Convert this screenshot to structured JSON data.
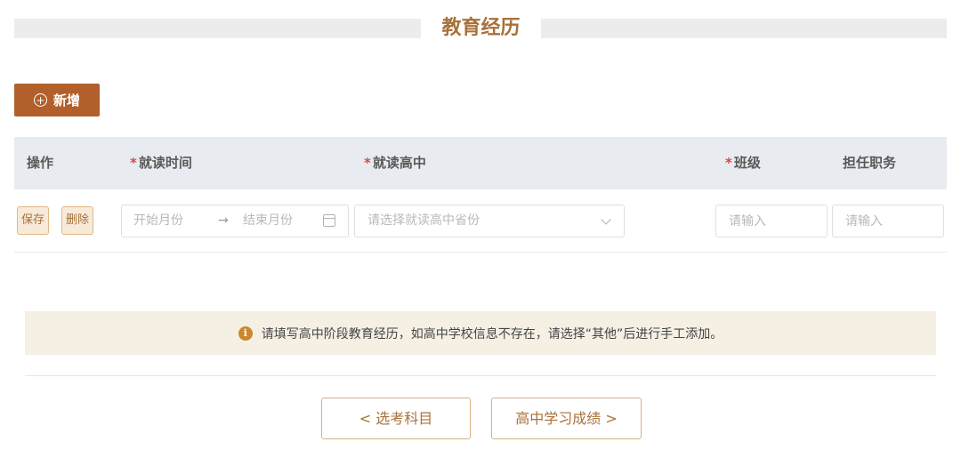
{
  "section": {
    "title": "教育经历"
  },
  "toolbar": {
    "add_label": "新增",
    "add_icon": "plus-circle-icon"
  },
  "table": {
    "columns": [
      {
        "label": "操作",
        "required": false
      },
      {
        "label": "就读时间",
        "required": true
      },
      {
        "label": "就读高中",
        "required": true
      },
      {
        "label": "班级",
        "required": true
      },
      {
        "label": "担任职务",
        "required": false
      }
    ],
    "required_mark": "*",
    "row": {
      "save_label": "保存",
      "delete_label": "删除",
      "date_start_placeholder": "开始月份",
      "date_separator": "→",
      "date_end_placeholder": "结束月份",
      "school_placeholder": "请选择就读高中省份",
      "class_placeholder": "请输入",
      "position_placeholder": "请输入"
    }
  },
  "notice": {
    "text": "请填写高中阶段教育经历，如高中学校信息不存在，请选择“其他”后进行手工添加。",
    "icon": "info-icon",
    "icon_glyph": "i"
  },
  "nav": {
    "prev_label": "< 选考科目",
    "next_label": "高中学习成绩 >"
  },
  "colors": {
    "accent": "#b25f2c",
    "title": "#a8713a",
    "required": "#e0453a",
    "notice_bg": "#f5efe4"
  }
}
